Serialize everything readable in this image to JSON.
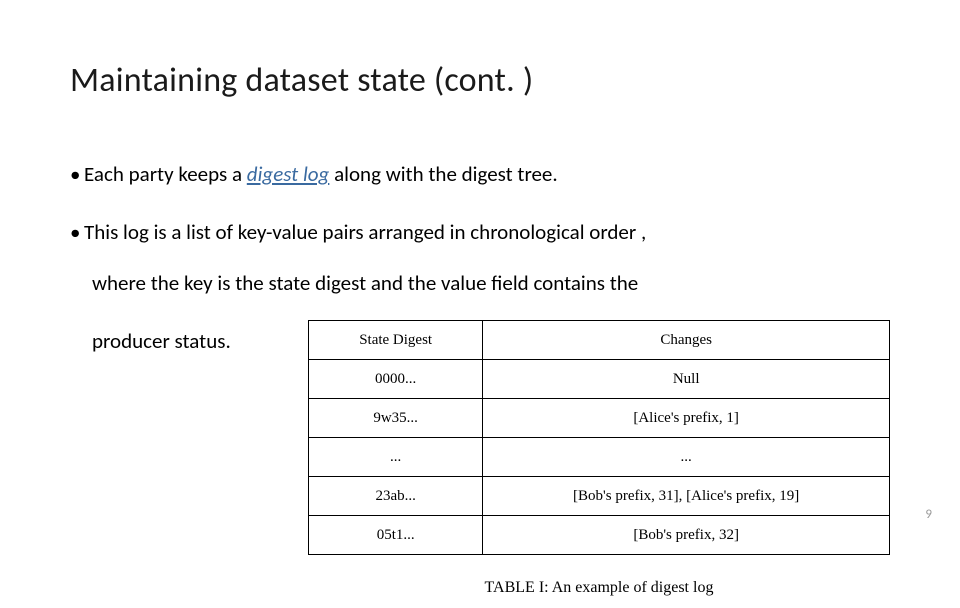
{
  "title": "Maintaining dataset state (cont. )",
  "bullet1": {
    "pre": "Each party keeps a ",
    "emph": "digest log",
    "post": " along with the digest tree."
  },
  "bullet2": {
    "line1": "This log is a list of key-value pairs arranged in chronological order ,",
    "line2": "where the key is the state digest and the value field contains the",
    "line3": "producer status."
  },
  "table": {
    "headers": {
      "c1": "State Digest",
      "c2": "Changes"
    },
    "rows": [
      {
        "c1": "0000...",
        "c2": "Null"
      },
      {
        "c1": "9w35...",
        "c2": "[Alice's prefix, 1]"
      },
      {
        "c1": "...",
        "c2": "..."
      },
      {
        "c1": "23ab...",
        "c2": "[Bob's prefix, 31], [Alice's prefix, 19]"
      },
      {
        "c1": "05t1...",
        "c2": "[Bob's prefix, 32]"
      }
    ],
    "caption": "TABLE I: An example of digest log"
  },
  "page_number": "9",
  "dot": "•"
}
